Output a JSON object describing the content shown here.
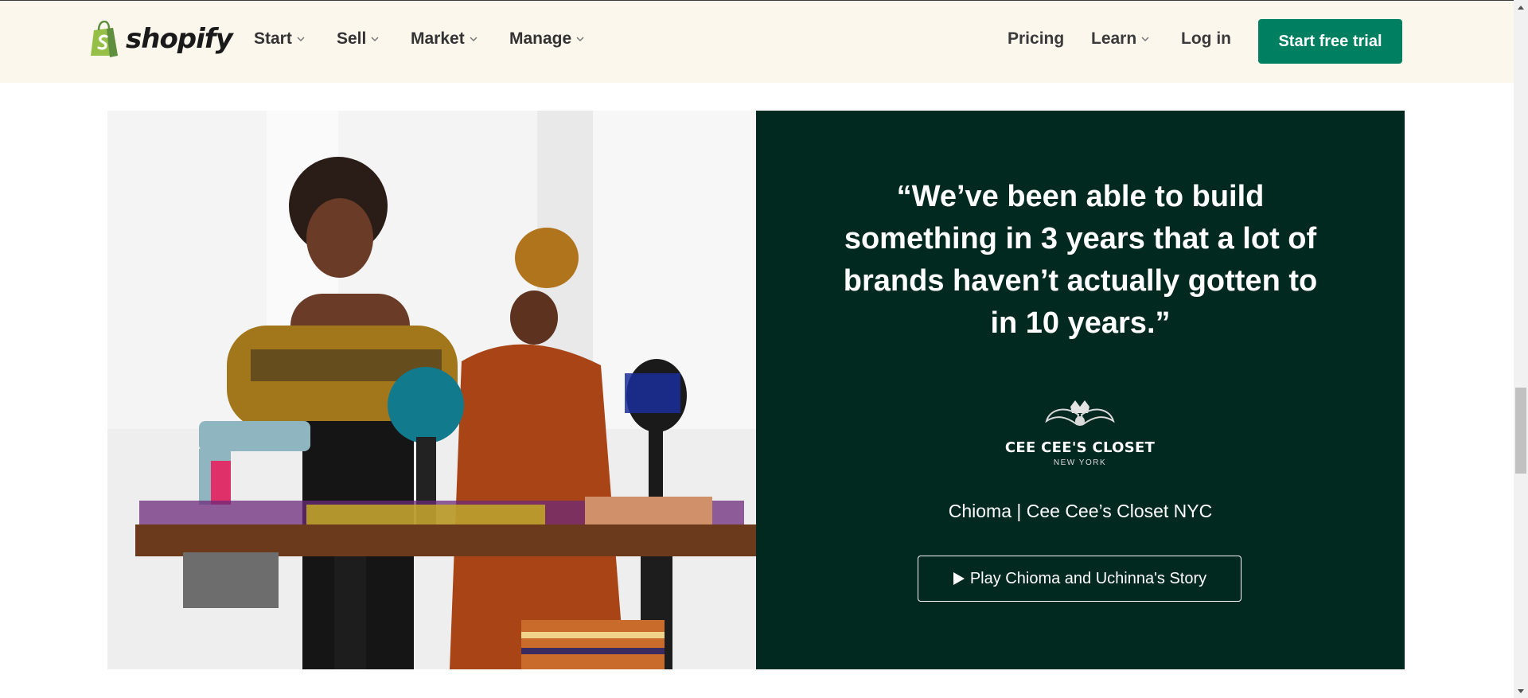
{
  "header": {
    "logo_text": "shopify",
    "nav": [
      {
        "label": "Start"
      },
      {
        "label": "Sell"
      },
      {
        "label": "Market"
      },
      {
        "label": "Manage"
      }
    ],
    "right_nav": {
      "pricing": "Pricing",
      "learn": "Learn",
      "login": "Log in",
      "cta": "Start free trial"
    }
  },
  "testimonial": {
    "quote": "“We’ve been able to build something in 3 years that a lot of brands haven’t actually gotten to in 10 years.”",
    "brand_logo_name": "CEE CEE'S CLOSET",
    "brand_logo_sub": "NEW YORK",
    "attribution": "Chioma | Cee Cee’s Closet NYC",
    "play_button": "Play Chioma and Uchinna's Story"
  },
  "colors": {
    "header_bg": "#fbf7ed",
    "cta_green": "#008060",
    "panel_dark_green": "#02291f"
  }
}
